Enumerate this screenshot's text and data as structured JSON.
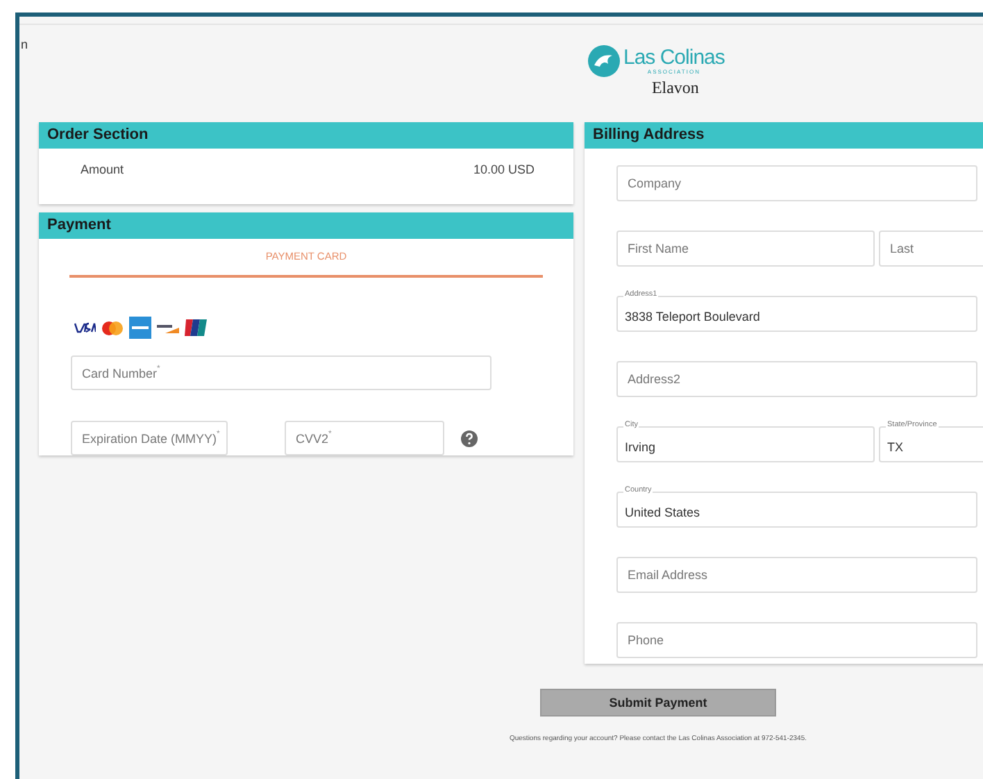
{
  "edge_text": "n",
  "logo": {
    "name": "Las Colinas",
    "subtitle": "ASSOCIATION",
    "partner": "Elavon"
  },
  "order_section": {
    "title": "Order Section",
    "amount_label": "Amount",
    "amount_value": "10.00 USD"
  },
  "payment": {
    "title": "Payment",
    "tabs": [
      {
        "label": "PAYMENT CARD",
        "selected": true
      }
    ],
    "card_number": {
      "placeholder": "Card Number",
      "required_mark": "*"
    },
    "expiration": {
      "placeholder": "Expiration Date (MMYY)",
      "required_mark": "*"
    },
    "cvv": {
      "placeholder": "CVV2",
      "required_mark": "*"
    }
  },
  "billing": {
    "title": "Billing Address",
    "rows": [
      [
        {
          "placeholder": "Company"
        }
      ],
      [
        {
          "placeholder": "First Name"
        },
        {
          "placeholder": "Last"
        }
      ],
      [
        {
          "label": "Address1",
          "value": "3838 Teleport Boulevard"
        }
      ],
      [
        {
          "placeholder": "Address2"
        }
      ],
      [
        {
          "label": "City",
          "value": "Irving"
        },
        {
          "label": "State/Province",
          "value": "TX"
        }
      ],
      [
        {
          "label": "Country",
          "value": "United States"
        }
      ],
      [
        {
          "placeholder": "Email Address"
        }
      ],
      [
        {
          "placeholder": "Phone"
        }
      ]
    ]
  },
  "submit_button": "Submit Payment",
  "footer": "Questions regarding your account? Please contact the Las Colinas Association at 972-541-2345."
}
